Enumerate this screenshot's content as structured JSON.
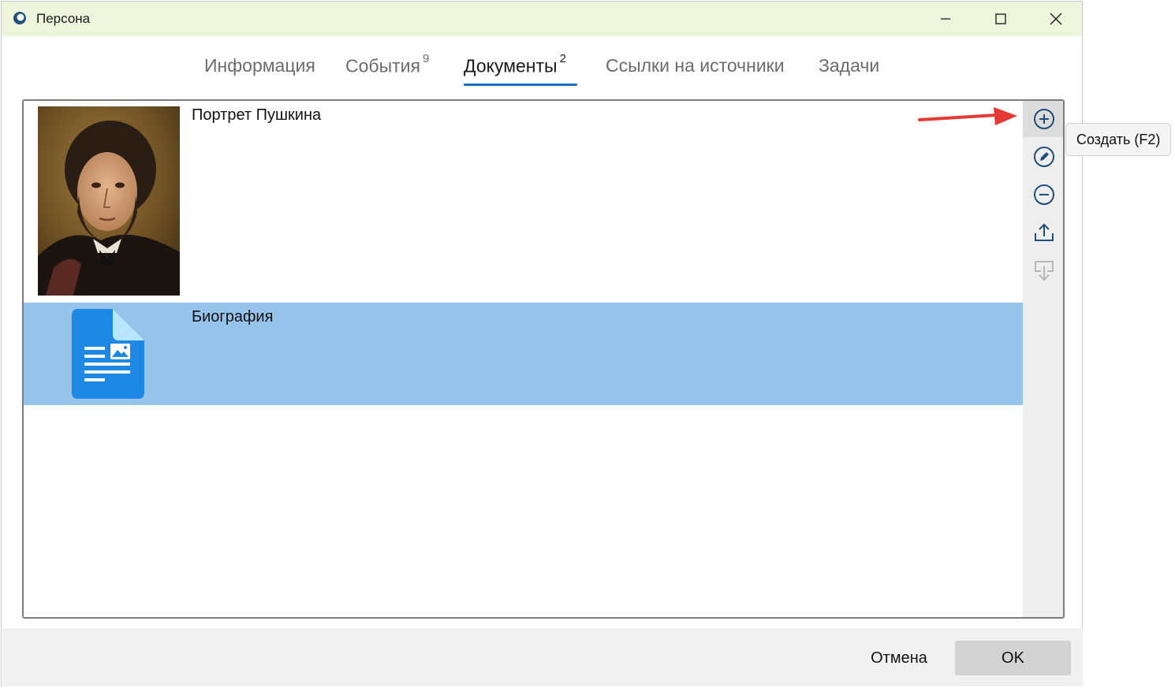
{
  "window": {
    "title": "Персона"
  },
  "tabs": [
    {
      "label": "Информация",
      "count": ""
    },
    {
      "label": "События",
      "count": "9"
    },
    {
      "label": "Документы",
      "count": "2",
      "active": true
    },
    {
      "label": "Ссылки на источники",
      "count": ""
    },
    {
      "label": "Задачи",
      "count": ""
    }
  ],
  "documents": [
    {
      "title": "Портрет Пушкина",
      "thumbnail": "portrait-image"
    },
    {
      "title": "Биография",
      "thumbnail": "document-icon",
      "selected": true
    }
  ],
  "toolbar": {
    "buttons": [
      {
        "icon": "plus-circle-icon",
        "enabled": true
      },
      {
        "icon": "edit-circle-icon",
        "enabled": true
      },
      {
        "icon": "minus-circle-icon",
        "enabled": true
      },
      {
        "icon": "upload-icon",
        "enabled": true
      },
      {
        "icon": "download-icon",
        "enabled": false
      }
    ],
    "tooltip": "Создать (F2)"
  },
  "footer": {
    "cancel_label": "Отмена",
    "ok_label": "OK"
  },
  "colors": {
    "titlebar": "#eef5dd",
    "accent": "#1a6fc2",
    "selection": "#95c3ea",
    "icon": "#1f4e79",
    "annotation_arrow": "#e53935"
  }
}
